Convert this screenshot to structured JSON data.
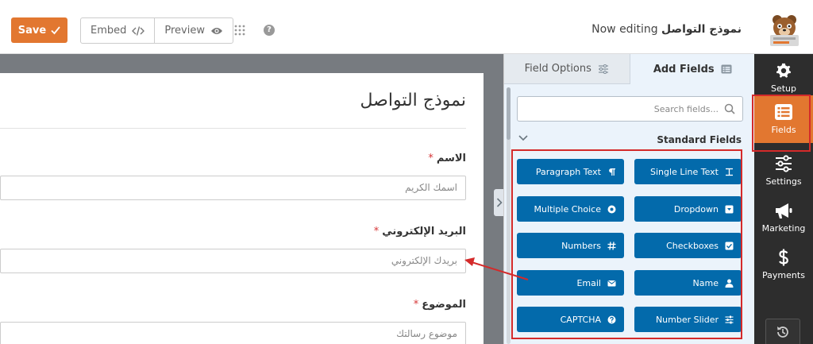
{
  "toolbar": {
    "save_label": "Save",
    "embed_label": "Embed",
    "preview_label": "Preview",
    "help_glyph": "?",
    "editing_prefix": "Now editing",
    "form_name": "نموذج التواصل"
  },
  "form": {
    "title": "نموذج التواصل",
    "required_mark": "*",
    "fields": [
      {
        "label": "الاسم",
        "placeholder": "اسمك الكريم"
      },
      {
        "label": "البريد الإلكتروني",
        "placeholder": "بريدك الإلكتروني"
      },
      {
        "label": "الموضوع",
        "placeholder": "موضوع رسالتك"
      }
    ]
  },
  "panel": {
    "tabs": {
      "field_options": "Field Options",
      "add_fields": "Add Fields"
    },
    "active_tab": "add_fields",
    "search_placeholder": "Search fields...",
    "section_title": "Standard Fields",
    "buttons": [
      {
        "label": "Single Line Text",
        "icon": "text-lines-icon"
      },
      {
        "label": "Paragraph Text",
        "icon": "paragraph-icon"
      },
      {
        "label": "Dropdown",
        "icon": "dropdown-icon"
      },
      {
        "label": "Multiple Choice",
        "icon": "radio-icon"
      },
      {
        "label": "Checkboxes",
        "icon": "checkbox-icon"
      },
      {
        "label": "Numbers",
        "icon": "hash-icon"
      },
      {
        "label": "Name",
        "icon": "user-icon"
      },
      {
        "label": "Email",
        "icon": "envelope-icon"
      },
      {
        "label": "Number Slider",
        "icon": "sliders-icon"
      },
      {
        "label": "CAPTCHA",
        "icon": "question-circle-icon"
      }
    ]
  },
  "sidebar": {
    "items": [
      {
        "label": "Setup",
        "icon": "gear-icon"
      },
      {
        "label": "Fields",
        "icon": "list-icon",
        "active": true
      },
      {
        "label": "Settings",
        "icon": "sliders-icon"
      },
      {
        "label": "Marketing",
        "icon": "megaphone-icon"
      },
      {
        "label": "Payments",
        "icon": "dollar-icon"
      }
    ],
    "history_icon": "history-icon"
  },
  "colors": {
    "accent_orange": "#e27730",
    "field_button_blue": "#036aab",
    "sidebar_dark": "#2d2d2d",
    "highlight_red": "#d42a2a",
    "required_red": "#d63638"
  }
}
